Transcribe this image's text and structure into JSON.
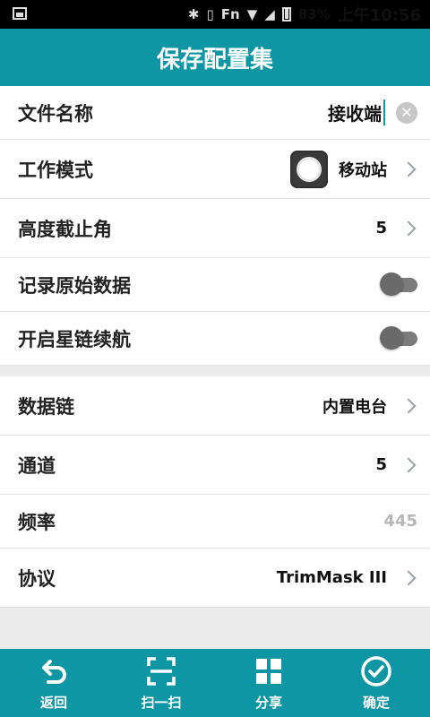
{
  "status_bar": {
    "battery_percent": "83%",
    "time": "上午10:56",
    "fn_label": "Fn"
  },
  "header": {
    "title": "保存配置集"
  },
  "settings": {
    "file_name": {
      "label": "文件名称",
      "value": "接收端"
    },
    "work_mode": {
      "label": "工作模式",
      "value": "移动站",
      "icon": "mobile-station-icon"
    },
    "elevation_mask": {
      "label": "高度截止角",
      "value": "5"
    },
    "record_raw": {
      "label": "记录原始数据",
      "state": "off"
    },
    "star_link": {
      "label": "开启星链续航",
      "state": "off"
    }
  },
  "datalink": {
    "data_link": {
      "label": "数据链",
      "value": "内置电台"
    },
    "channel": {
      "label": "通道",
      "value": "5"
    },
    "frequency": {
      "label": "频率",
      "value": "445"
    },
    "protocol": {
      "label": "协议",
      "value": "TrimMask III"
    }
  },
  "bottom_bar": {
    "back_label": "返回",
    "scan_label": "扫一扫",
    "share_label": "分享",
    "confirm_label": "确定"
  },
  "colors": {
    "primary": "#0f96a5",
    "status_bar": "#000000",
    "background": "#ebebeb"
  }
}
